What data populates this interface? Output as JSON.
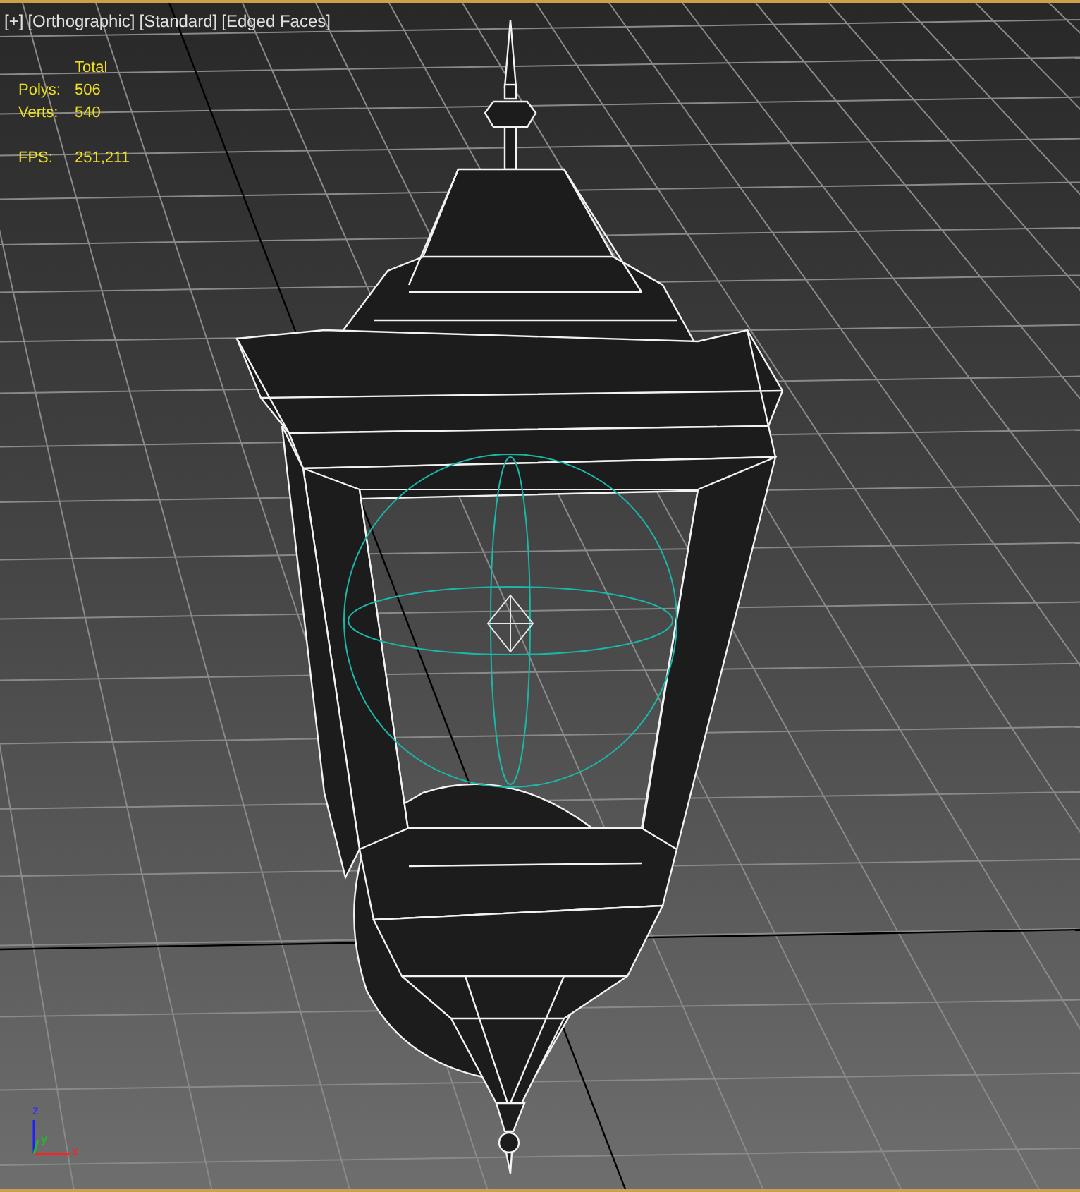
{
  "viewport": {
    "active": true,
    "labels": [
      {
        "text": "[+]"
      },
      {
        "text": "[Orthographic]"
      },
      {
        "text": "[Standard]"
      },
      {
        "text": "[Edged Faces]"
      }
    ],
    "stats": {
      "header": "Total",
      "rows": [
        {
          "label": "Polys:",
          "value": "506"
        },
        {
          "label": "Verts:",
          "value": "540"
        }
      ],
      "fps": {
        "label": "FPS:",
        "value": "251,211"
      }
    },
    "axis_gizmo": {
      "z": "z",
      "y": "y",
      "x": "x"
    }
  }
}
